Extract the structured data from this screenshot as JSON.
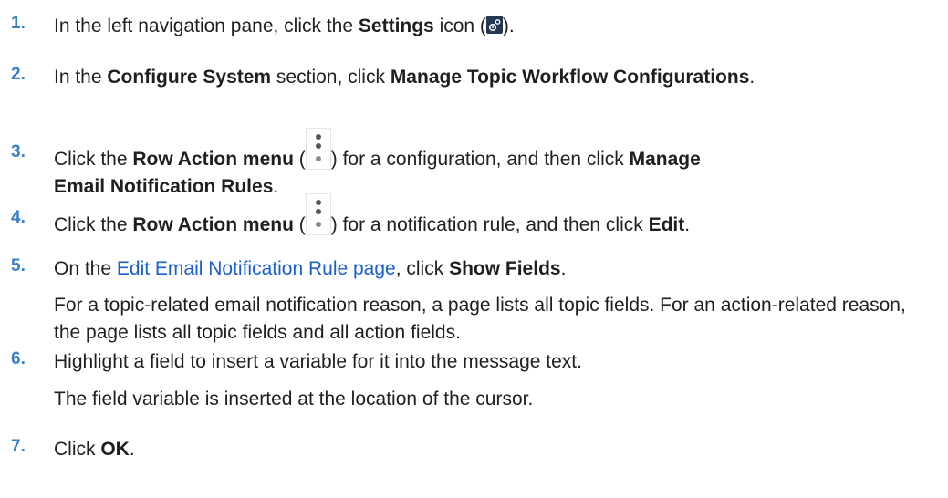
{
  "steps": [
    {
      "num": "1.",
      "parts": [
        {
          "t": "In the left navigation pane, click the "
        },
        {
          "t": "Settings",
          "b": true
        },
        {
          "t": " icon ("
        },
        {
          "icon": "gear-icon"
        },
        {
          "t": ")."
        }
      ]
    },
    {
      "num": "2.",
      "parts": [
        {
          "t": "In the "
        },
        {
          "t": "Configure System",
          "b": true
        },
        {
          "t": " section, click "
        },
        {
          "t": "Manage Topic Workflow Configurations",
          "b": true
        },
        {
          "t": "."
        }
      ]
    },
    {
      "num": "3.",
      "parts": [
        {
          "t": "Click the "
        },
        {
          "t": "Row Action menu",
          "b": true
        },
        {
          "t": " ("
        },
        {
          "icon": "more-vertical-icon"
        },
        {
          "t": ") for a configuration, and then click "
        },
        {
          "t": "Manage Email Notification Rules",
          "b": true
        },
        {
          "t": "."
        }
      ]
    },
    {
      "num": "4.",
      "parts": [
        {
          "t": "Click the "
        },
        {
          "t": "Row Action menu",
          "b": true
        },
        {
          "t": " ("
        },
        {
          "icon": "more-vertical-icon"
        },
        {
          "t": ") for a notification rule, and then click "
        },
        {
          "t": "Edit",
          "b": true
        },
        {
          "t": "."
        }
      ]
    },
    {
      "num": "5.",
      "parts": [
        {
          "t": "On the "
        },
        {
          "t": "Edit Email Notification Rule page",
          "link": true
        },
        {
          "t": ", click "
        },
        {
          "t": "Show Fields",
          "b": true
        },
        {
          "t": "."
        }
      ],
      "note": "For a topic-related email notification reason, a page lists all topic fields. For an action-related reason, the page lists all topic fields and all action fields."
    },
    {
      "num": "6.",
      "parts": [
        {
          "t": "Highlight a field to insert a variable for it into the message text."
        }
      ],
      "note": "The field variable is inserted at the location of the cursor."
    },
    {
      "num": "7.",
      "parts": [
        {
          "t": "Click "
        },
        {
          "t": "OK",
          "b": true
        },
        {
          "t": "."
        }
      ]
    }
  ]
}
